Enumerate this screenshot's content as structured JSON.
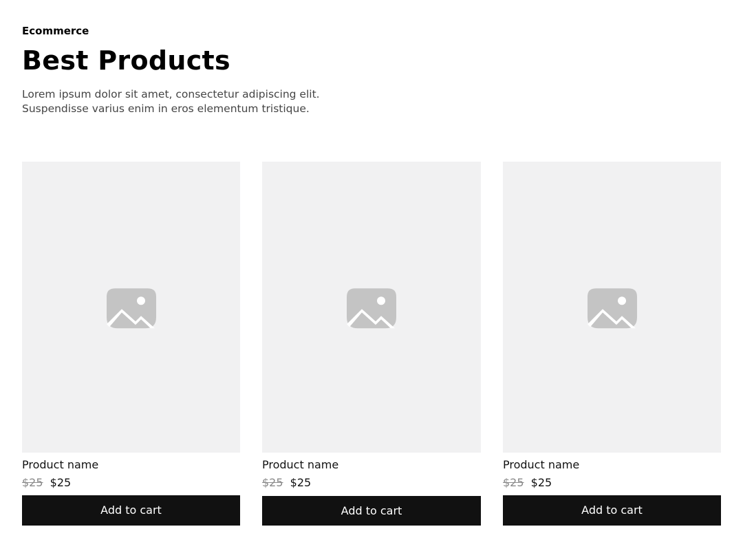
{
  "header": {
    "eyebrow": "Ecommerce",
    "title": "Best Products",
    "description_lines": [
      "Lorem ipsum dolor sit amet, consectetur adipiscing elit.",
      "Suspendisse varius enim in eros elementum tristique."
    ]
  },
  "colors": {
    "placeholder_bg": "#f1f1f2",
    "placeholder_icon": "#c4c4c4",
    "button_bg": "#111111",
    "button_text": "#ffffff",
    "old_price": "#8a8a8a"
  },
  "products": [
    {
      "image_icon": "image-placeholder-icon",
      "name": "Product name",
      "old_price": "$25",
      "price": "$25",
      "button_label": "Add to cart"
    },
    {
      "image_icon": "image-placeholder-icon",
      "name": "Product name",
      "old_price": "$25",
      "price": "$25",
      "button_label": "Add to cart"
    },
    {
      "image_icon": "image-placeholder-icon",
      "name": "Product name",
      "old_price": "$25",
      "price": "$25",
      "button_label": "Add to cart"
    }
  ]
}
